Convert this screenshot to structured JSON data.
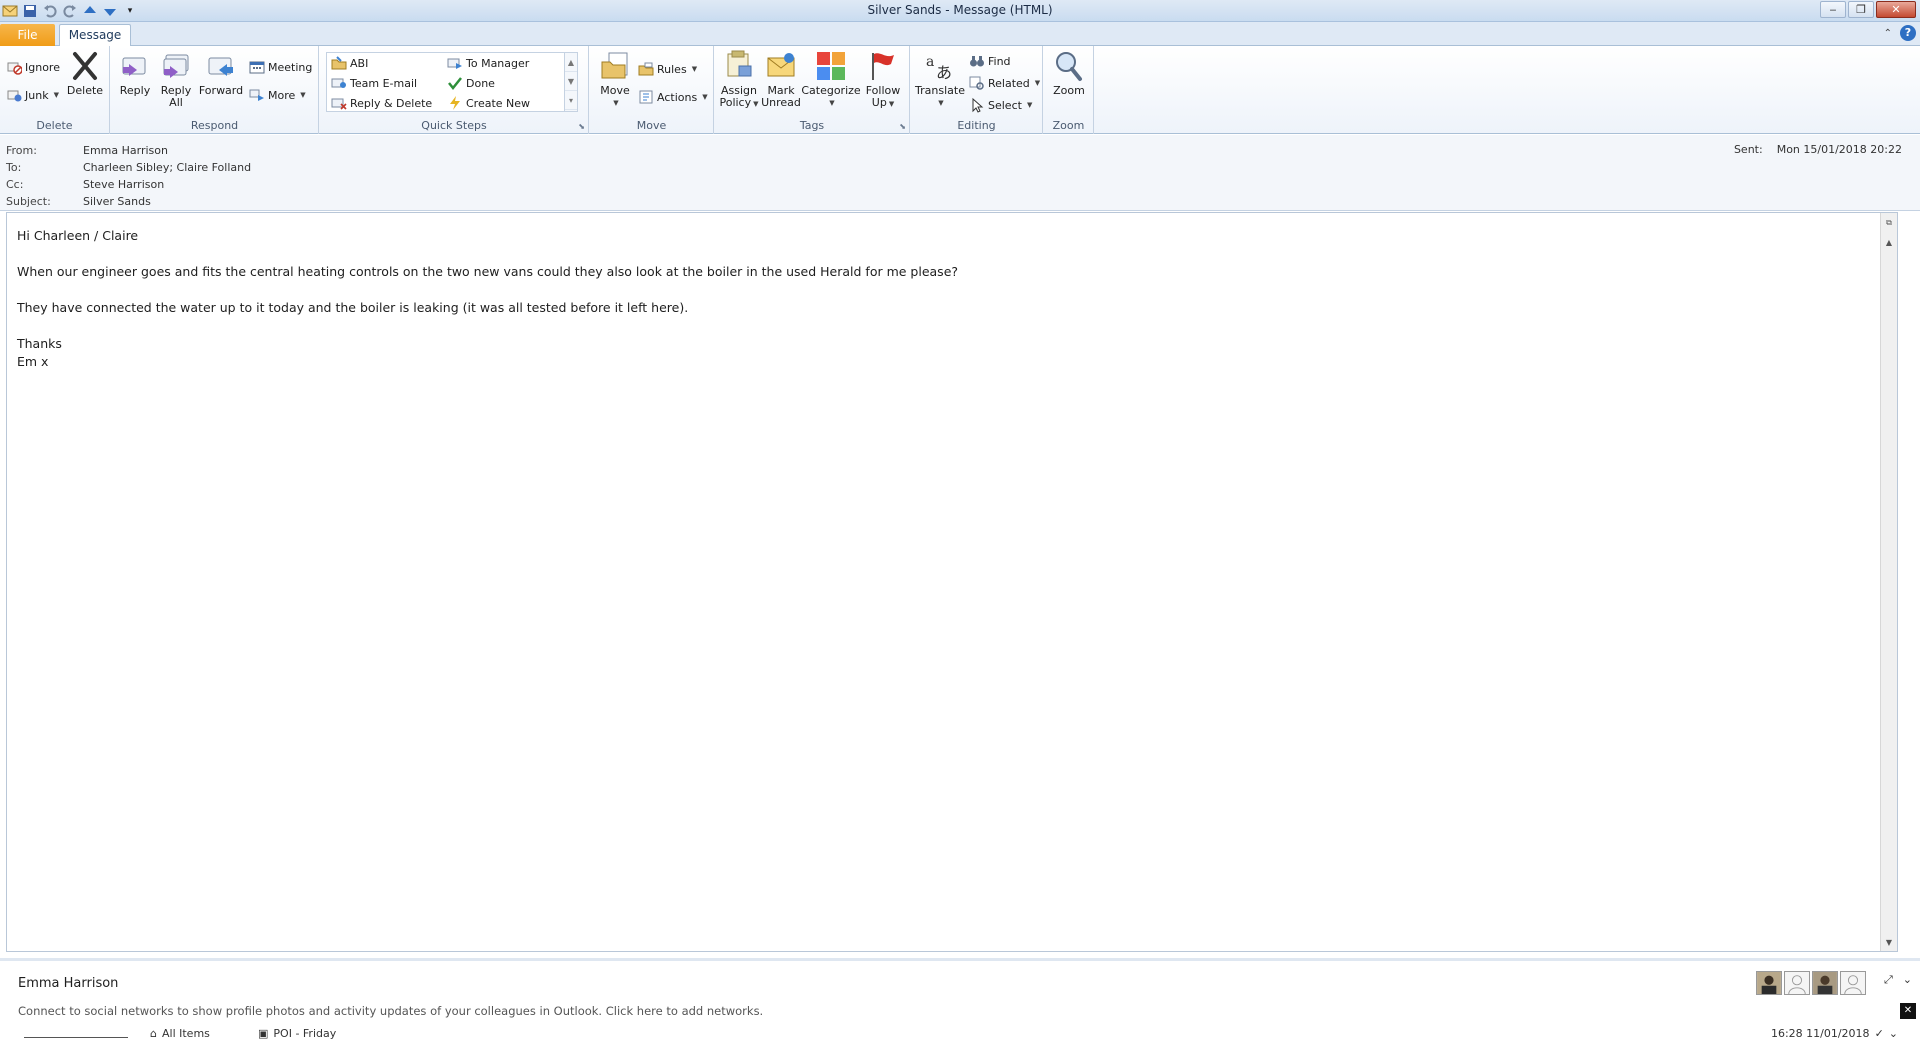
{
  "window": {
    "title": "Silver Sands  -  Message (HTML)",
    "controls": {
      "minimize": "‒",
      "restore": "❐",
      "close": "✕"
    }
  },
  "tabs": {
    "file": "File",
    "message": "Message"
  },
  "ribbon": {
    "delete_group": {
      "label": "Delete",
      "ignore": "Ignore",
      "junk": "Junk",
      "delete": "Delete"
    },
    "respond_group": {
      "label": "Respond",
      "reply": "Reply",
      "reply_all_1": "Reply",
      "reply_all_2": "All",
      "forward": "Forward",
      "meeting": "Meeting",
      "more": "More"
    },
    "quicksteps_group": {
      "label": "Quick Steps",
      "items": [
        "ABI",
        "To Manager",
        "Team E-mail",
        "Done",
        "Reply & Delete",
        "Create New"
      ]
    },
    "move_group": {
      "label": "Move",
      "move": "Move",
      "rules": "Rules",
      "actions": "Actions"
    },
    "tags_group": {
      "label": "Tags",
      "assign_1": "Assign",
      "assign_2": "Policy",
      "mark_1": "Mark",
      "mark_2": "Unread",
      "categorize": "Categorize",
      "follow_1": "Follow",
      "follow_2": "Up"
    },
    "editing_group": {
      "label": "Editing",
      "translate": "Translate",
      "find": "Find",
      "related": "Related",
      "select": "Select"
    },
    "zoom_group": {
      "label": "Zoom",
      "zoom": "Zoom"
    }
  },
  "header": {
    "from_label": "From:",
    "from": "Emma Harrison",
    "to_label": "To:",
    "to": "Charleen Sibley; Claire Folland",
    "cc_label": "Cc:",
    "cc": "Steve Harrison",
    "subject_label": "Subject:",
    "subject": "Silver Sands",
    "sent_label": "Sent:",
    "sent": "Mon 15/01/2018 20:22"
  },
  "body": {
    "greeting": "Hi Charleen / Claire",
    "para1": "When our engineer goes and fits the central heating controls on the two new vans could they also look at the boiler in the used Herald for me please?",
    "para2": "They have connected the water up to it today and the boiler is leaking (it was all tested before it left here).",
    "thanks": "Thanks",
    "signoff": "Em x"
  },
  "people_pane": {
    "name": "Emma Harrison",
    "connect_text": "Connect to social networks to show profile photos and activity updates of your colleagues in Outlook. Click here to add networks."
  },
  "status": {
    "all_items": "All Items",
    "poi": "POI - Friday",
    "datetime": "16:28 11/01/2018"
  },
  "colors": {
    "file_tab": "#f09c18",
    "flag": "#d8322a",
    "accent": "#2e6fc3"
  }
}
